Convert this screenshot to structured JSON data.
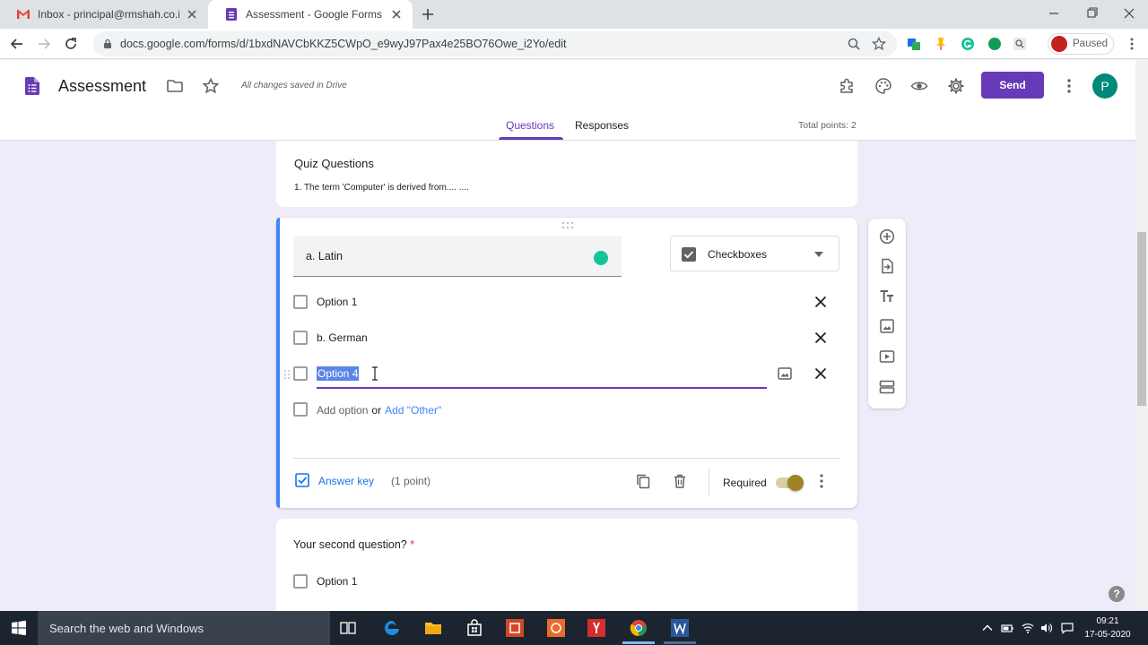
{
  "browser": {
    "tabs": [
      {
        "title": "Inbox - principal@rmshah.co.in -",
        "active": false
      },
      {
        "title": "Assessment - Google Forms",
        "active": true
      }
    ],
    "url": "docs.google.com/forms/d/1bxdNAVCbKKZ5CWpO_e9wyJ97Pax4e25BO76Owe_i2Yo/edit",
    "profile_status": "Paused"
  },
  "form": {
    "title": "Assessment",
    "save_status": "All changes saved in Drive",
    "send_label": "Send",
    "avatar_letter": "P",
    "tabs": [
      {
        "label": "Questions",
        "active": true
      },
      {
        "label": "Responses",
        "active": false
      }
    ],
    "total_points": "Total points: 2"
  },
  "section": {
    "title": "Quiz Questions",
    "description": "1. The term 'Computer' is derived from.... ...."
  },
  "question": {
    "title": "a. Latin",
    "type": "Checkboxes",
    "options": [
      {
        "label": "Option 1"
      },
      {
        "label": "b. German"
      },
      {
        "label": "Option 4"
      }
    ],
    "add_option": "Add option",
    "or": "or",
    "add_other": "Add \"Other\"",
    "answer_key": "Answer key",
    "points": "(1 point)",
    "required_label": "Required",
    "required": true
  },
  "question2": {
    "title": "Your second question?",
    "required_mark": "*",
    "options": [
      {
        "label": "Option 1"
      }
    ]
  },
  "taskbar": {
    "search_placeholder": "Search the web and Windows",
    "time": "09:21",
    "date": "17-05-2020"
  },
  "colors": {
    "accent": "#673ab7",
    "active_bar": "#4285f4",
    "background": "#f0ebf8"
  }
}
